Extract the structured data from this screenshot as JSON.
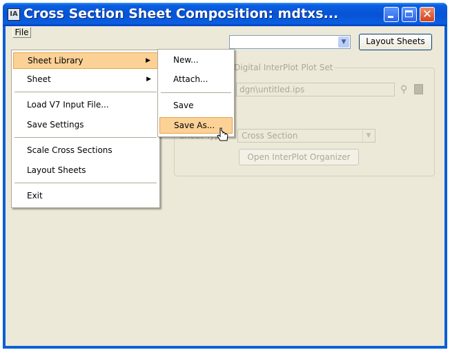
{
  "window": {
    "title": "Cross Section Sheet Composition: mdtxs...",
    "icon_glyph": "ΙΑ"
  },
  "menubar": {
    "file_label": "File"
  },
  "file_menu": {
    "items": [
      {
        "label": "Sheet Library",
        "submenu": true
      },
      {
        "label": "Sheet",
        "submenu": true
      },
      {
        "label": "Load V7 Input File..."
      },
      {
        "label": "Save Settings"
      },
      {
        "label": "Scale Cross Sections"
      },
      {
        "label": "Layout Sheets"
      },
      {
        "label": "Exit"
      }
    ]
  },
  "sheet_library_menu": {
    "items": [
      {
        "label": "New..."
      },
      {
        "label": "Attach..."
      },
      {
        "label": "Save"
      },
      {
        "label": "Save As..."
      }
    ]
  },
  "main": {
    "layout_sheets_button": "Layout Sheets",
    "group_title": "Digital InterPlot Plot Set",
    "plot_set_path": "dgn\\untitled.ips",
    "sheet_type_label": "Sheet Type:",
    "sheet_type_value": "Cross Section",
    "organizer_button": "Open InterPlot Organizer"
  },
  "colors": {
    "titlebar": "#0a5fe0",
    "menu_highlight": "#fbd196",
    "face": "#ece9d8"
  }
}
